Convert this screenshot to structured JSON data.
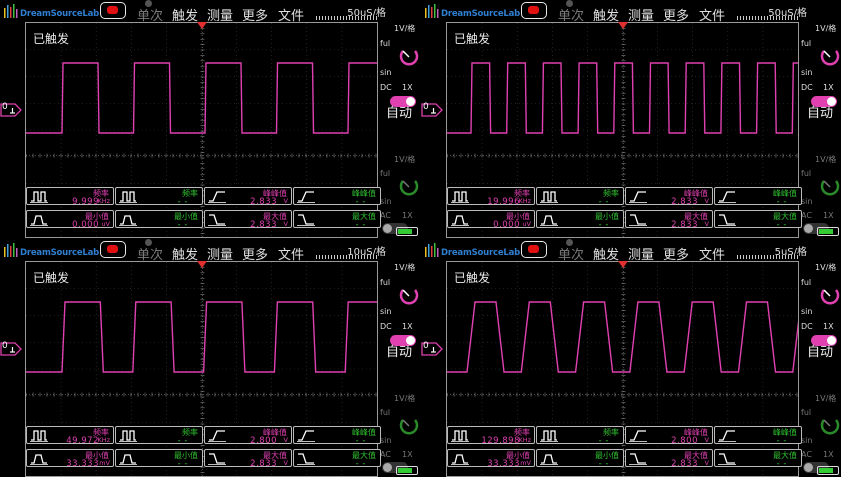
{
  "app": {
    "logo": "DreamSourceLab",
    "menu": {
      "single": "单次",
      "trigger": "触发",
      "measure": "测量",
      "more": "更多",
      "file": "文件"
    },
    "status": "已触发",
    "auto_label": "自动",
    "ch0_label": "0",
    "colors": {
      "ch0": "#e040b0",
      "ch1": "#30c030",
      "stop": "#e01010",
      "logo": "#2f7fd0"
    }
  },
  "panels": [
    {
      "timebase": "50uS/格",
      "ch0": {
        "vdiv": "1V/格",
        "ful": "ful",
        "sin": "sin",
        "coupling": "DC",
        "probe": "1X"
      },
      "ch1": {
        "vdiv": "1V/格",
        "ful": "ful",
        "sin": "sin",
        "coupling": "AC",
        "probe": "1X"
      },
      "measurements": [
        {
          "label": "频率",
          "value": "9.999",
          "unit": "KHz",
          "color": "ch0",
          "icon": "period-icon"
        },
        {
          "label": "频率",
          "value": "- -",
          "unit": "",
          "color": "ch1",
          "icon": "period-icon"
        },
        {
          "label": "峰峰值",
          "value": "2.833",
          "unit": "V",
          "color": "ch0",
          "icon": "rise-icon"
        },
        {
          "label": "峰峰值",
          "value": "- -",
          "unit": "",
          "color": "ch1",
          "icon": "rise-icon"
        },
        {
          "label": "最小值",
          "value": "0.000",
          "unit": "uV",
          "color": "ch0",
          "icon": "pulse-icon"
        },
        {
          "label": "最小值",
          "value": "- -",
          "unit": "",
          "color": "ch1",
          "icon": "pulse-icon"
        },
        {
          "label": "最大值",
          "value": "2.833",
          "unit": "V",
          "color": "ch0",
          "icon": "fall-icon"
        },
        {
          "label": "最大值",
          "value": "- -",
          "unit": "",
          "color": "ch1",
          "icon": "fall-icon"
        }
      ]
    },
    {
      "timebase": "50uS/格",
      "ch0": {
        "vdiv": "1V/格",
        "ful": "ful",
        "sin": "sin",
        "coupling": "DC",
        "probe": "1X"
      },
      "ch1": {
        "vdiv": "1V/格",
        "ful": "ful",
        "sin": "sin",
        "coupling": "AC",
        "probe": "1X"
      },
      "measurements": [
        {
          "label": "频率",
          "value": "19.996",
          "unit": "KHz",
          "color": "ch0",
          "icon": "period-icon"
        },
        {
          "label": "频率",
          "value": "- -",
          "unit": "",
          "color": "ch1",
          "icon": "period-icon"
        },
        {
          "label": "峰峰值",
          "value": "2.833",
          "unit": "V",
          "color": "ch0",
          "icon": "rise-icon"
        },
        {
          "label": "峰峰值",
          "value": "- -",
          "unit": "",
          "color": "ch1",
          "icon": "rise-icon"
        },
        {
          "label": "最小值",
          "value": "0.000",
          "unit": "uV",
          "color": "ch0",
          "icon": "pulse-icon"
        },
        {
          "label": "最小值",
          "value": "- -",
          "unit": "",
          "color": "ch1",
          "icon": "pulse-icon"
        },
        {
          "label": "最大值",
          "value": "2.833",
          "unit": "V",
          "color": "ch0",
          "icon": "fall-icon"
        },
        {
          "label": "最大值",
          "value": "- -",
          "unit": "",
          "color": "ch1",
          "icon": "fall-icon"
        }
      ]
    },
    {
      "timebase": "10uS/格",
      "ch0": {
        "vdiv": "1V/格",
        "ful": "ful",
        "sin": "sin",
        "coupling": "DC",
        "probe": "1X"
      },
      "ch1": {
        "vdiv": "1V/格",
        "ful": "ful",
        "sin": "sin",
        "coupling": "AC",
        "probe": "1X"
      },
      "measurements": [
        {
          "label": "频率",
          "value": "49.972",
          "unit": "KHz",
          "color": "ch0",
          "icon": "period-icon"
        },
        {
          "label": "频率",
          "value": "- -",
          "unit": "",
          "color": "ch1",
          "icon": "period-icon"
        },
        {
          "label": "峰峰值",
          "value": "2.800",
          "unit": "V",
          "color": "ch0",
          "icon": "rise-icon"
        },
        {
          "label": "峰峰值",
          "value": "- -",
          "unit": "",
          "color": "ch1",
          "icon": "rise-icon"
        },
        {
          "label": "最小值",
          "value": "33.333",
          "unit": "mV",
          "color": "ch0",
          "icon": "pulse-icon"
        },
        {
          "label": "最小值",
          "value": "- -",
          "unit": "",
          "color": "ch1",
          "icon": "pulse-icon"
        },
        {
          "label": "最大值",
          "value": "2.833",
          "unit": "V",
          "color": "ch0",
          "icon": "fall-icon"
        },
        {
          "label": "最大值",
          "value": "- -",
          "unit": "",
          "color": "ch1",
          "icon": "fall-icon"
        }
      ]
    },
    {
      "timebase": "5uS/格",
      "ch0": {
        "vdiv": "1V/格",
        "ful": "ful",
        "sin": "sin",
        "coupling": "DC",
        "probe": "1X"
      },
      "ch1": {
        "vdiv": "1V/格",
        "ful": "ful",
        "sin": "sin",
        "coupling": "AC",
        "probe": "1X"
      },
      "measurements": [
        {
          "label": "频率",
          "value": "129.898",
          "unit": "KHz",
          "color": "ch0",
          "icon": "period-icon"
        },
        {
          "label": "频率",
          "value": "- -",
          "unit": "",
          "color": "ch1",
          "icon": "period-icon"
        },
        {
          "label": "峰峰值",
          "value": "2.800",
          "unit": "V",
          "color": "ch0",
          "icon": "rise-icon"
        },
        {
          "label": "峰峰值",
          "value": "- -",
          "unit": "",
          "color": "ch1",
          "icon": "rise-icon"
        },
        {
          "label": "最小值",
          "value": "33.333",
          "unit": "mV",
          "color": "ch0",
          "icon": "pulse-icon"
        },
        {
          "label": "最小值",
          "value": "- -",
          "unit": "",
          "color": "ch1",
          "icon": "pulse-icon"
        },
        {
          "label": "最大值",
          "value": "2.833",
          "unit": "V",
          "color": "ch0",
          "icon": "fall-icon"
        },
        {
          "label": "最大值",
          "value": "- -",
          "unit": "",
          "color": "ch1",
          "icon": "fall-icon"
        }
      ]
    }
  ]
}
